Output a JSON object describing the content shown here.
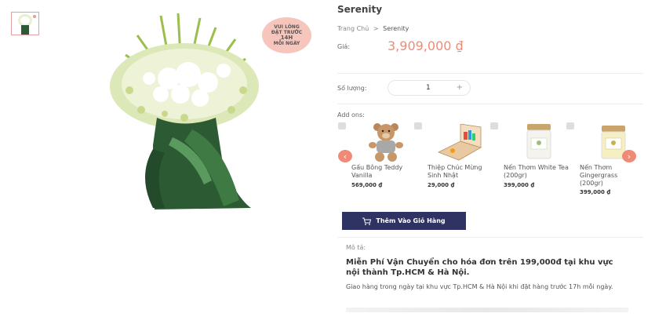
{
  "product": {
    "title": "Serenity",
    "badge": [
      "VUI LÒNG",
      "ĐẶT TRƯỚC",
      "14H",
      "MỖI NGÀY"
    ],
    "breadcrumb": {
      "home": "Trang Chủ",
      "separator": ">",
      "current": "Serenity"
    },
    "price_label": "Giá:",
    "price": "3,909,000 ₫"
  },
  "quantity": {
    "label": "Số lượng:",
    "value": "1",
    "plus": "+"
  },
  "addons": {
    "label": "Add ons:",
    "items": [
      {
        "name": "Gấu Bông Teddy Vanilla",
        "price": "569,000 ₫",
        "icon": "teddy-bear-icon"
      },
      {
        "name": "Thiệp Chúc Mừng Sinh Nhật",
        "price": "29,000 ₫",
        "icon": "greeting-card-icon"
      },
      {
        "name": "Nến Thơm White Tea (200gr)",
        "price": "399,000 ₫",
        "icon": "candle-icon"
      },
      {
        "name": "Nến Thơm Gingergrass (200gr)",
        "price": "399,000 ₫",
        "icon": "candle-icon"
      }
    ]
  },
  "cart_button": {
    "label": "Thêm Vào Giỏ Hàng",
    "icon": "cart-icon"
  },
  "description": {
    "label": "Mô tả:",
    "heading": "Miễn Phí Vận Chuyển cho hóa đơn trên 199,000đ tại khu vực nội thành Tp.HCM & Hà Nội.",
    "body": "Giao hàng trong ngày tại khu vực Tp.HCM & Hà Nội khi đặt hàng trước 17h mỗi ngày."
  },
  "colors": {
    "accent": "#f08a76",
    "button": "#2f3363"
  }
}
